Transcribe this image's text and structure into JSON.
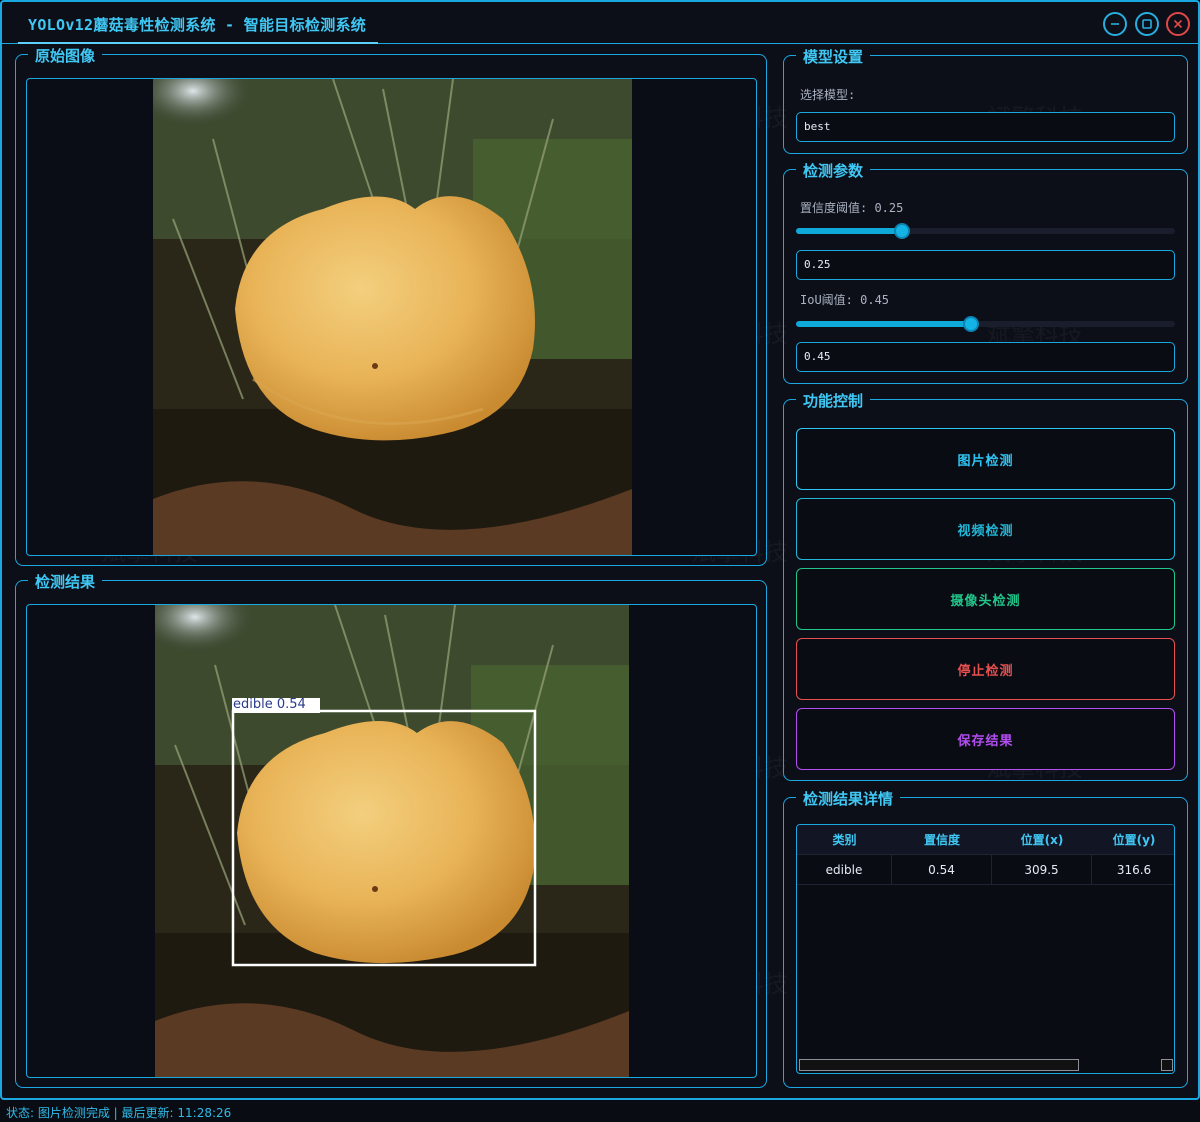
{
  "window": {
    "title": "YOLOv12蘑菇毒性检测系统 - 智能目标检测系统"
  },
  "watermark": "斌擎科技",
  "original_panel": {
    "title": "原始图像"
  },
  "result_panel": {
    "title": "检测结果",
    "detection_label": "edible 0.54"
  },
  "model_settings": {
    "title": "模型设置",
    "select_label": "选择模型:",
    "selected_model": "best"
  },
  "detect_params": {
    "title": "检测参数",
    "confidence_label": "置信度阈值: 0.25",
    "confidence_value": "0.25",
    "confidence_fraction": 0.25,
    "iou_label": "IoU阈值: 0.45",
    "iou_value": "0.45",
    "iou_fraction": 0.45
  },
  "function_control": {
    "title": "功能控制",
    "buttons": [
      {
        "label": "图片检测",
        "color": "#2fc6f5"
      },
      {
        "label": "视频检测",
        "color": "#22b7d8"
      },
      {
        "label": "摄像头检测",
        "color": "#22c58a"
      },
      {
        "label": "停止检测",
        "color": "#e65050"
      },
      {
        "label": "保存结果",
        "color": "#b24df0"
      }
    ]
  },
  "results_table": {
    "title": "检测结果详情",
    "columns": [
      "类别",
      "置信度",
      "位置(x)",
      "位置(y)"
    ],
    "rows": [
      [
        "edible",
        "0.54",
        "309.5",
        "316.6"
      ]
    ]
  },
  "status_bar": {
    "text": "状态: 图片检测完成 | 最后更新: 11:28:26"
  },
  "colors": {
    "accent": "#19a9e0",
    "title_text": "#3fc8f4",
    "background": "#0c0e18",
    "close": "#e04848"
  }
}
